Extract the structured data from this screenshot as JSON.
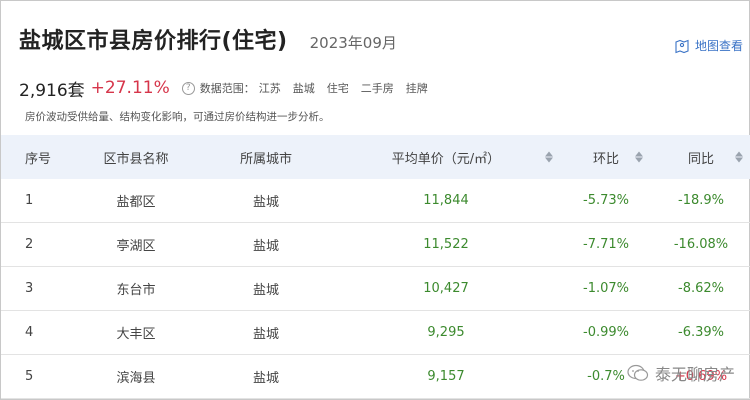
{
  "header": {
    "title": "盐城区市县房价排行(住宅)",
    "date": "2023年09月",
    "map_link": "地图查看"
  },
  "stats": {
    "total": "2,916套",
    "change": "+27.11%",
    "help": "?",
    "range_label": "数据范围：",
    "tags": [
      "江苏",
      "盐城",
      "住宅",
      "二手房",
      "挂牌"
    ]
  },
  "note": "房价波动受供给量、结构变化影响，可通过房价结构进一步分析。",
  "table": {
    "headers": [
      "序号",
      "区市县名称",
      "所属城市",
      "平均单价（元/㎡）",
      "环比",
      "同比"
    ],
    "rows": [
      {
        "no": "1",
        "name": "盐都区",
        "city": "盐城",
        "price": "11,844",
        "mom": "-5.73%",
        "yoy": "-18.9%"
      },
      {
        "no": "2",
        "name": "亭湖区",
        "city": "盐城",
        "price": "11,522",
        "mom": "-7.71%",
        "yoy": "-16.08%"
      },
      {
        "no": "3",
        "name": "东台市",
        "city": "盐城",
        "price": "10,427",
        "mom": "-1.07%",
        "yoy": "-8.62%"
      },
      {
        "no": "4",
        "name": "大丰区",
        "city": "盐城",
        "price": "9,295",
        "mom": "-0.99%",
        "yoy": "-6.39%"
      },
      {
        "no": "5",
        "name": "滨海县",
        "city": "盐城",
        "price": "9,157",
        "mom": "-0.7%",
        "yoy": "+0.69%"
      }
    ]
  },
  "watermark": "泰无聊房产",
  "colors": {
    "accent": "#3a73c6",
    "up": "#d6354a",
    "down": "#3c8a2e",
    "header_bg": "#edf2fa"
  }
}
